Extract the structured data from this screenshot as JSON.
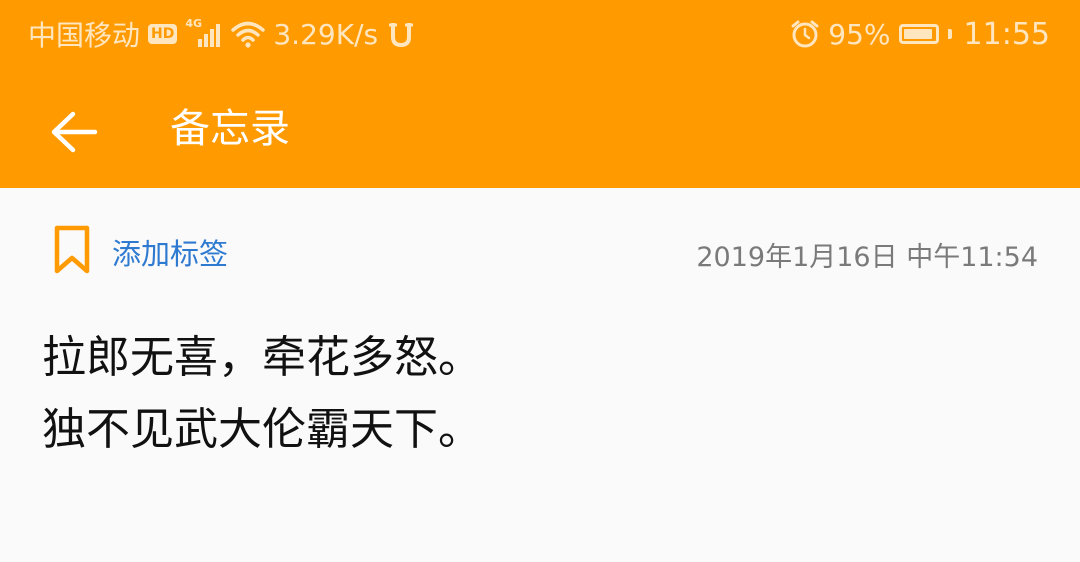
{
  "status_bar": {
    "carrier": "中国移动",
    "hd_badge": "HD",
    "network_type": "4G",
    "speed": "3.29K/s",
    "battery": "95%",
    "battery_level": 0.95,
    "time": "11:55",
    "icons": [
      "hd-icon",
      "signal-icon",
      "wifi-icon",
      "notification-app-icon",
      "alarm-icon",
      "battery-icon"
    ]
  },
  "toolbar": {
    "back_icon": "arrow-left-icon",
    "title": "备忘录"
  },
  "note": {
    "tag_icon": "bookmark-icon",
    "add_tag_label": "添加标签",
    "date": "2019年1月16日 中午11:54",
    "lines": [
      "拉郎无喜，牵花多怒。",
      "独不见武大伦霸天下。"
    ]
  },
  "colors": {
    "header_bg": "#ff9a00",
    "status_text": "#ffe6bf",
    "accent_blue": "#2f7ad1",
    "bookmark_orange": "#ff9a00",
    "page_bg": "#fafafa",
    "date_gray": "#7a7a7a",
    "body_text": "#111111"
  }
}
